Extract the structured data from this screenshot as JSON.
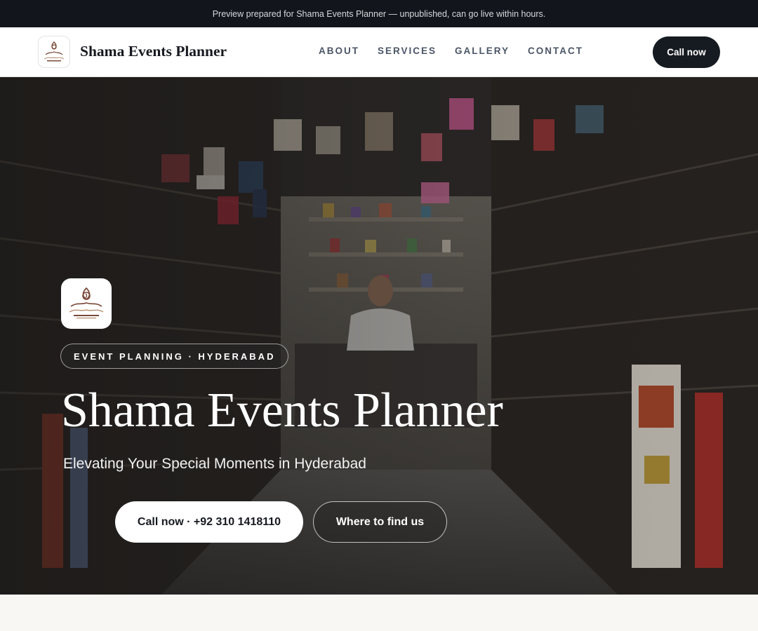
{
  "preview_banner": {
    "text": "Preview prepared for Shama Events Planner — unpublished, can go live within hours."
  },
  "header": {
    "brand_name": "Shama Events Planner",
    "logo_icon": "shama-logo-icon",
    "nav": [
      {
        "label": "ABOUT"
      },
      {
        "label": "SERVICES"
      },
      {
        "label": "GALLERY"
      },
      {
        "label": "CONTACT"
      }
    ],
    "cta_label": "Call now"
  },
  "hero": {
    "background": "shop-interior-photo",
    "tag": "EVENT PLANNING · HYDERABAD",
    "title": "Shama Events Planner",
    "subtitle": "Elevating Your Special Moments in Hyderabad",
    "primary_button": "Call now · +92 310 1418110",
    "secondary_button": "Where to find us"
  },
  "colors": {
    "dark": "#12151b",
    "cta_dark": "#161a21",
    "logo_brown": "#7a4a3a",
    "page_bg": "#f8f7f4"
  }
}
